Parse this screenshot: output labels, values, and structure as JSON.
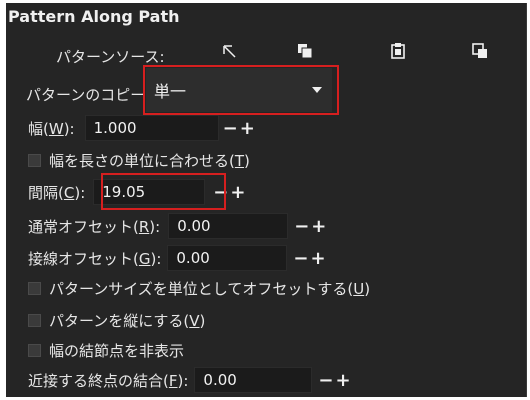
{
  "panel": {
    "title": "Pattern Along Path",
    "pattern_source_label": "パターンソース:",
    "icons": [
      "edit-on-canvas-icon",
      "copy-icon",
      "paste-icon",
      "link-to-clipboard-icon"
    ]
  },
  "copies": {
    "label": "パターンのコピー:",
    "value": "単一"
  },
  "width": {
    "label_prefix": "幅(",
    "mnemonic": "W",
    "label_suffix": "):",
    "value": "1.000",
    "minus": "−",
    "plus": "+"
  },
  "width_length": {
    "label_prefix": "幅を長さの単位に合わせる(",
    "mnemonic": "T",
    "label_suffix": ")",
    "checked": false
  },
  "spacing": {
    "label_prefix": "間隔(",
    "mnemonic": "C",
    "label_suffix": "):",
    "value": "19.05"
  },
  "normal_offset": {
    "label_prefix": "通常オフセット(",
    "mnemonic": "R",
    "label_suffix": "):",
    "value": "0.00"
  },
  "tangential_offset": {
    "label_prefix": "接線オフセット(",
    "mnemonic": "G",
    "label_suffix": "):",
    "value": "0.00"
  },
  "offsets_unit": {
    "label_prefix": "パターンサイズを単位としてオフセットする(",
    "mnemonic": "U",
    "label_suffix": ")",
    "checked": false
  },
  "vertical": {
    "label_prefix": "パターンを縦にする(",
    "mnemonic": "V",
    "label_suffix": ")",
    "checked": false
  },
  "hide_knot": {
    "label": "幅の結節点を非表示",
    "checked": false
  },
  "fuse": {
    "label_prefix": "近接する終点の結合(",
    "mnemonic": "F",
    "label_suffix": "):",
    "value": "0.00"
  },
  "colors": {
    "panel_bg": "#252525",
    "highlight": "#d61f1f"
  }
}
